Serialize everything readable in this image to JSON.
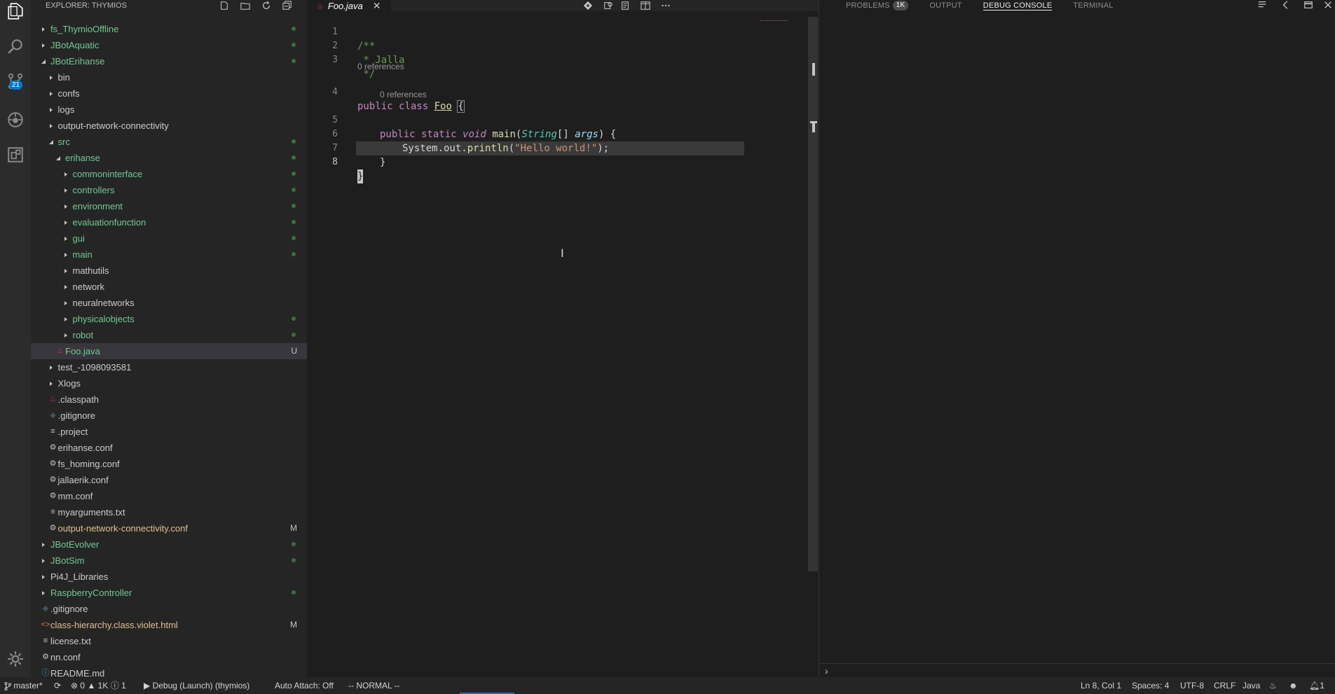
{
  "activity_bar": {
    "icons": [
      "files-icon",
      "search-icon",
      "source-control-icon",
      "debug-icon",
      "extensions-icon",
      "settings-gear-icon"
    ],
    "scm_badge": "21"
  },
  "sidebar": {
    "title": "EXPLORER: THYMIOS",
    "actions": [
      "new-file-icon",
      "new-folder-icon",
      "refresh-icon",
      "collapse-all-icon"
    ],
    "tree": [
      {
        "label": "fs_ThymioOffline",
        "depth": 0,
        "kind": "folder",
        "expanded": false,
        "color": "green",
        "dot": true
      },
      {
        "label": "JBotAquatic",
        "depth": 0,
        "kind": "folder",
        "expanded": false,
        "color": "green",
        "dot": true
      },
      {
        "label": "JBotErihanse",
        "depth": 0,
        "kind": "folder",
        "expanded": true,
        "color": "green",
        "dot": true
      },
      {
        "label": "bin",
        "depth": 1,
        "kind": "folder",
        "expanded": false,
        "color": "default"
      },
      {
        "label": "confs",
        "depth": 1,
        "kind": "folder",
        "expanded": false,
        "color": "default"
      },
      {
        "label": "logs",
        "depth": 1,
        "kind": "folder",
        "expanded": false,
        "color": "default"
      },
      {
        "label": "output-network-connectivity",
        "depth": 1,
        "kind": "folder",
        "expanded": false,
        "color": "default"
      },
      {
        "label": "src",
        "depth": 1,
        "kind": "folder",
        "expanded": true,
        "color": "green",
        "dot": true
      },
      {
        "label": "erihanse",
        "depth": 2,
        "kind": "folder",
        "expanded": true,
        "color": "green",
        "dot": true
      },
      {
        "label": "commoninterface",
        "depth": 3,
        "kind": "folder",
        "expanded": false,
        "color": "green",
        "dot": true
      },
      {
        "label": "controllers",
        "depth": 3,
        "kind": "folder",
        "expanded": false,
        "color": "green",
        "dot": true
      },
      {
        "label": "environment",
        "depth": 3,
        "kind": "folder",
        "expanded": false,
        "color": "green",
        "dot": true
      },
      {
        "label": "evaluationfunction",
        "depth": 3,
        "kind": "folder",
        "expanded": false,
        "color": "green",
        "dot": true
      },
      {
        "label": "gui",
        "depth": 3,
        "kind": "folder",
        "expanded": false,
        "color": "green",
        "dot": true
      },
      {
        "label": "main",
        "depth": 3,
        "kind": "folder",
        "expanded": false,
        "color": "green",
        "dot": true
      },
      {
        "label": "mathutils",
        "depth": 3,
        "kind": "folder",
        "expanded": false,
        "color": "default"
      },
      {
        "label": "network",
        "depth": 3,
        "kind": "folder",
        "expanded": false,
        "color": "default"
      },
      {
        "label": "neuralnetworks",
        "depth": 3,
        "kind": "folder",
        "expanded": false,
        "color": "default"
      },
      {
        "label": "physicalobjects",
        "depth": 3,
        "kind": "folder",
        "expanded": false,
        "color": "green",
        "dot": true
      },
      {
        "label": "robot",
        "depth": 3,
        "kind": "folder",
        "expanded": false,
        "color": "green",
        "dot": true
      },
      {
        "label": "Foo.java",
        "depth": 2,
        "kind": "java",
        "color": "green",
        "letter": "U",
        "selected": true
      },
      {
        "label": "test_-1098093581",
        "depth": 1,
        "kind": "folder",
        "expanded": false,
        "color": "default"
      },
      {
        "label": "Xlogs",
        "depth": 1,
        "kind": "folder",
        "expanded": false,
        "color": "default"
      },
      {
        "label": ".classpath",
        "depth": 1,
        "kind": "java",
        "color": "default"
      },
      {
        "label": ".gitignore",
        "depth": 1,
        "kind": "git",
        "color": "default"
      },
      {
        "label": ".project",
        "depth": 1,
        "kind": "text",
        "color": "default"
      },
      {
        "label": "erihanse.conf",
        "depth": 1,
        "kind": "gear",
        "color": "default"
      },
      {
        "label": "fs_homing.conf",
        "depth": 1,
        "kind": "gear",
        "color": "default"
      },
      {
        "label": "jallaerik.conf",
        "depth": 1,
        "kind": "gear",
        "color": "default"
      },
      {
        "label": "mm.conf",
        "depth": 1,
        "kind": "gear",
        "color": "default"
      },
      {
        "label": "myarguments.txt",
        "depth": 1,
        "kind": "text",
        "color": "default"
      },
      {
        "label": "output-network-connectivity.conf",
        "depth": 1,
        "kind": "gear",
        "color": "orange",
        "letter": "M"
      },
      {
        "label": "JBotEvolver",
        "depth": 0,
        "kind": "folder",
        "expanded": false,
        "color": "green",
        "dot": true
      },
      {
        "label": "JBotSim",
        "depth": 0,
        "kind": "folder",
        "expanded": false,
        "color": "green",
        "dot": true
      },
      {
        "label": "Pi4J_Libraries",
        "depth": 0,
        "kind": "folder",
        "expanded": false,
        "color": "default"
      },
      {
        "label": "RaspberryController",
        "depth": 0,
        "kind": "folder",
        "expanded": false,
        "color": "green",
        "dot": true
      },
      {
        "label": ".gitignore",
        "depth": 0,
        "kind": "git",
        "color": "default"
      },
      {
        "label": "class-hierarchy.class.violet.html",
        "depth": 0,
        "kind": "html",
        "color": "orange",
        "letter": "M"
      },
      {
        "label": "license.txt",
        "depth": 0,
        "kind": "text",
        "color": "default"
      },
      {
        "label": "nn.conf",
        "depth": 0,
        "kind": "gear",
        "color": "default"
      },
      {
        "label": "README.md",
        "depth": 0,
        "kind": "info",
        "color": "default"
      }
    ]
  },
  "editor": {
    "tab_label": "Foo.java",
    "actions": [
      "git-compare-icon",
      "open-changes-icon",
      "preview-icon",
      "split-editor-icon",
      "more-icon"
    ],
    "code_lens_1": "0 references",
    "code_lens_2": "0 references",
    "lines": {
      "l1": {
        "num": "1",
        "text": "/**"
      },
      "l2": {
        "num": "2",
        "text": " * Jalla"
      },
      "l3": {
        "num": "3",
        "text": " */"
      },
      "l4": {
        "num": "4",
        "kw1": "public",
        "kw2": "class",
        "cls": "Foo",
        "brace": "{"
      },
      "l5": {
        "num": "5",
        "kw1": "public",
        "kw2": "static",
        "kw3": "void",
        "fn": "main",
        "p1": "(",
        "type": "String",
        "p2": "[] ",
        "param": "args",
        "p3": ") {"
      },
      "l6": {
        "num": "6",
        "obj": "System.out.",
        "fn": "println",
        "p1": "(",
        "str": "\"Hello world!\"",
        "p2": ");"
      },
      "l7": {
        "num": "7",
        "text": "}"
      },
      "l8": {
        "num": "8",
        "text": "}"
      }
    }
  },
  "panel": {
    "tabs": [
      {
        "label": "PROBLEMS",
        "badge": "1K"
      },
      {
        "label": "OUTPUT"
      },
      {
        "label": "DEBUG CONSOLE"
      },
      {
        "label": "TERMINAL"
      }
    ],
    "active_tab": "DEBUG CONSOLE",
    "repl_prompt": "›"
  },
  "status_bar": {
    "branch": "master*",
    "errors": "0",
    "warnings": "1K",
    "infos": "1",
    "debug_config": "Debug (Launch) (thymios)",
    "auto_attach": "Auto Attach: Off",
    "vim_mode": "-- NORMAL --",
    "cursor_position": "Ln 8, Col 1",
    "indentation": "Spaces: 4",
    "encoding": "UTF-8",
    "line_ending": "CRLF",
    "language": "Java",
    "notifications": "1"
  }
}
